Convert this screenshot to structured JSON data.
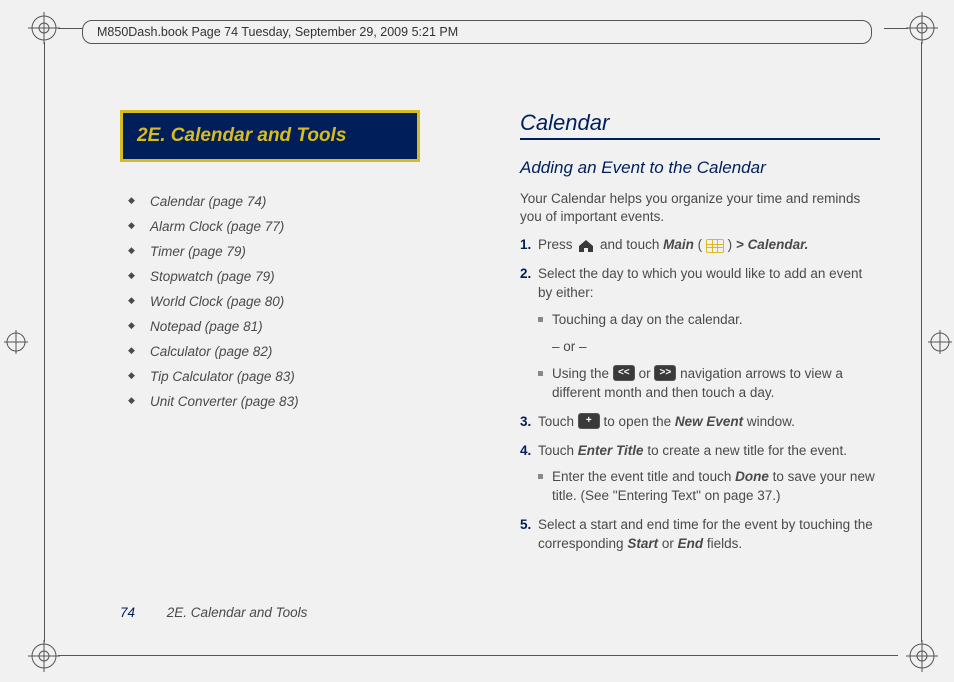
{
  "header_bar": "M850Dash.book  Page 74  Tuesday, September 29, 2009  5:21 PM",
  "section_banner": "2E.  Calendar and Tools",
  "toc": [
    "Calendar (page 74)",
    "Alarm Clock (page 77)",
    "Timer (page 79)",
    "Stopwatch (page 79)",
    "World Clock (page 80)",
    "Notepad (page 81)",
    "Calculator (page 82)",
    "Tip Calculator (page 83)",
    "Unit Converter (page 83)"
  ],
  "right": {
    "h1": "Calendar",
    "h2": "Adding an Event to the Calendar",
    "intro": "Your Calendar helps you organize your time and reminds you of important events.",
    "steps": {
      "s1a": "Press ",
      "s1b": " and touch ",
      "s1_main": "Main",
      "s1c": " (",
      "s1d": ") ",
      "s1_gt": ">",
      "s1_cal": " Calendar.",
      "s2": "Select the day to which you would like to add an event by either:",
      "s2_b1": "Touching a day on the calendar.",
      "s2_or": "– or –",
      "s2_b2a": "Using the ",
      "s2_b2b": " or ",
      "s2_b2c": " navigation arrows to view a different month and then touch a day.",
      "s3a": "Touch ",
      "s3b": " to open the ",
      "s3_ne": "New Event",
      "s3c": " window.",
      "s4a": "Touch ",
      "s4_et": "Enter Title",
      "s4b": " to create a new title for the event.",
      "s4_b1a": "Enter the event title and touch ",
      "s4_done": "Done",
      "s4_b1b": " to save your new title. (See \"Entering Text\" on page 37.)",
      "s5a": "Select a start and end time for the event by touching the corresponding ",
      "s5_start": "Start",
      "s5b": " or ",
      "s5_end": "End",
      "s5c": " fields."
    }
  },
  "footer": {
    "page_num": "74",
    "title": "2E. Calendar and Tools"
  },
  "icons": {
    "nav_prev": "<<",
    "nav_next": ">>",
    "plus": "+"
  }
}
